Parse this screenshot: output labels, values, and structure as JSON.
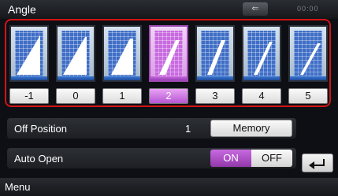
{
  "header": {
    "title": "Angle",
    "clock": "00:00",
    "back_icon": "back-arrow-icon"
  },
  "angle_options": [
    {
      "label": "-1",
      "selected": false
    },
    {
      "label": "0",
      "selected": false
    },
    {
      "label": "1",
      "selected": false
    },
    {
      "label": "2",
      "selected": true
    },
    {
      "label": "3",
      "selected": false
    },
    {
      "label": "4",
      "selected": false
    },
    {
      "label": "5",
      "selected": false
    }
  ],
  "off_position": {
    "label": "Off Position",
    "value": "1",
    "button_label": "Memory"
  },
  "auto_open": {
    "label": "Auto Open",
    "on_label": "ON",
    "off_label": "OFF",
    "state": "ON"
  },
  "footer": {
    "menu_label": "Menu"
  },
  "colors": {
    "selection_border": "#d21414",
    "selected_accent": "#c86ae0",
    "tile_blue": "#3f6ec6"
  }
}
